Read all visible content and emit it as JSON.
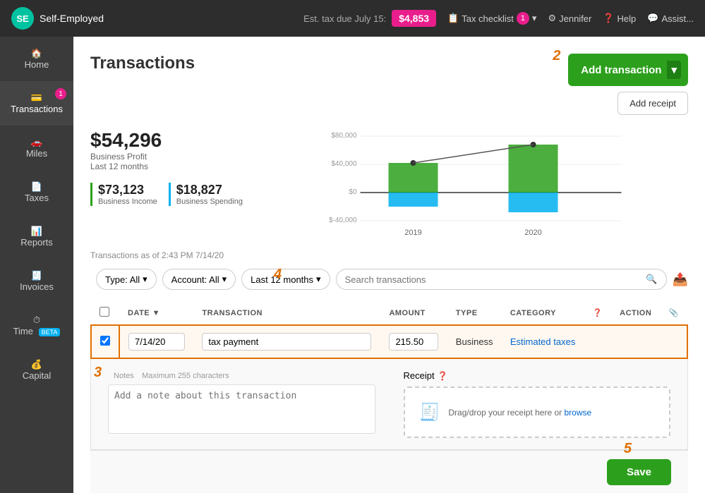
{
  "app": {
    "name": "Self-Employed",
    "logo_initial": "SE"
  },
  "header": {
    "est_tax_label": "Est. tax due July 15:",
    "tax_amount": "$4,853",
    "tax_checklist_label": "Tax checklist",
    "tax_checklist_count": "1",
    "user_name": "Jennifer",
    "help_label": "Help",
    "assist_label": "Assist..."
  },
  "sidebar": {
    "items": [
      {
        "label": "Home",
        "active": false,
        "badge": null,
        "id": "home"
      },
      {
        "label": "Transactions",
        "active": true,
        "badge": "1",
        "id": "transactions"
      },
      {
        "label": "Miles",
        "active": false,
        "badge": null,
        "id": "miles"
      },
      {
        "label": "Taxes",
        "active": false,
        "badge": null,
        "id": "taxes"
      },
      {
        "label": "Reports",
        "active": false,
        "badge": null,
        "id": "reports"
      },
      {
        "label": "Invoices",
        "active": false,
        "badge": null,
        "id": "invoices"
      },
      {
        "label": "Time",
        "active": false,
        "badge": null,
        "beta": true,
        "id": "time"
      },
      {
        "label": "Capital",
        "active": false,
        "badge": null,
        "id": "capital"
      }
    ]
  },
  "page": {
    "title": "Transactions",
    "add_transaction_label": "Add transaction",
    "add_receipt_label": "Add receipt"
  },
  "stats": {
    "profit_amount": "$54,296",
    "profit_label": "Business Profit",
    "profit_period": "Last 12 months",
    "income_amount": "$73,123",
    "income_label": "Business Income",
    "spending_amount": "$18,827",
    "spending_label": "Business Spending"
  },
  "chart": {
    "y_labels": [
      "$80,000",
      "$40,000",
      "$0",
      "$-40,000"
    ],
    "x_labels": [
      "2019",
      "2020"
    ],
    "bars_2019": {
      "income": 35000,
      "spending": -15000
    },
    "bars_2020": {
      "income": 55000,
      "spending": -20000
    }
  },
  "filters": {
    "type_label": "Type: All",
    "account_label": "Account: All",
    "period_label": "Last 12 months",
    "search_placeholder": "Search transactions"
  },
  "timestamp": "Transactions as of 2:43 PM 7/14/20",
  "table": {
    "columns": [
      "",
      "DATE ▼",
      "TRANSACTION",
      "",
      "AMOUNT",
      "TYPE",
      "CATEGORY",
      "?",
      "ACTION",
      ""
    ],
    "rows": [
      {
        "date": "7/14/20",
        "transaction": "tax payment",
        "amount": "215.50",
        "type": "Business",
        "category": "Estimated taxes",
        "selected": true
      }
    ]
  },
  "expanded": {
    "notes_label": "Notes",
    "notes_max": "Maximum 255 characters",
    "notes_placeholder": "Add a note about this transaction",
    "receipt_label": "Receipt",
    "receipt_question": "?",
    "receipt_drag_text": "Drag/drop your receipt here or",
    "receipt_browse": "browse"
  },
  "save_label": "Save",
  "step_indicators": {
    "s1": "1",
    "s2": "2",
    "s3": "3",
    "s4": "4",
    "s5": "5"
  }
}
